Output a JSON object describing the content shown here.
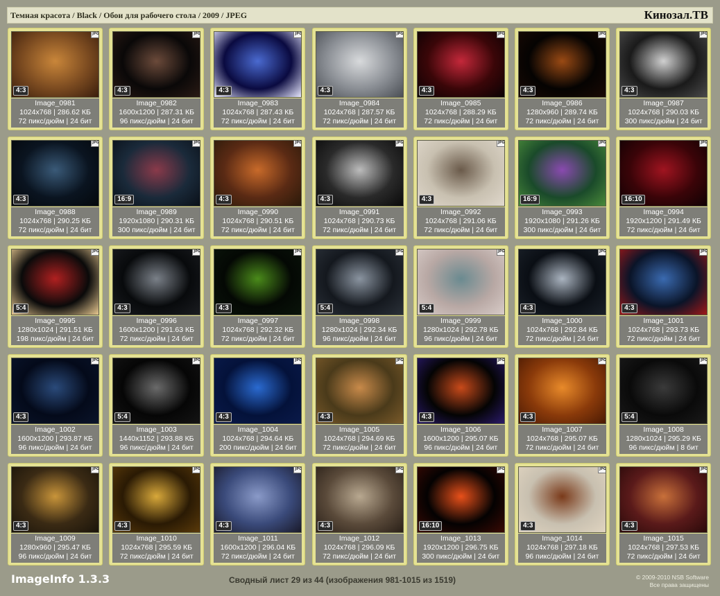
{
  "header": {
    "breadcrumb": "Темная красота / Black / Обои для рабочего стола / 2009 / JPEG",
    "brand": "Кинозал.ТВ"
  },
  "jpg_label": "JPG",
  "images": [
    {
      "name": "Image_0981",
      "dims": "1024x768",
      "size": "286.62 КБ",
      "dpi": "72 пикс/дюйм",
      "bits": "24 бит",
      "ratio": "4:3",
      "colors": [
        "#7a4a20",
        "#c9863a",
        "#3a1e0c"
      ]
    },
    {
      "name": "Image_0982",
      "dims": "1600x1200",
      "size": "287.31 КБ",
      "dpi": "96 пикс/дюйм",
      "bits": "24 бит",
      "ratio": "4:3",
      "colors": [
        "#0a0808",
        "#6b4a3a",
        "#2a1a14"
      ]
    },
    {
      "name": "Image_0983",
      "dims": "1024x768",
      "size": "287.43 КБ",
      "dpi": "72 пикс/дюйм",
      "bits": "24 бит",
      "ratio": "4:3",
      "colors": [
        "#0a0a40",
        "#4a6ad0",
        "#e8e8ff"
      ]
    },
    {
      "name": "Image_0984",
      "dims": "1024x768",
      "size": "287.57 КБ",
      "dpi": "72 пикс/дюйм",
      "bits": "24 бит",
      "ratio": "4:3",
      "colors": [
        "#8a8e94",
        "#d8dadc",
        "#4a4e54"
      ]
    },
    {
      "name": "Image_0985",
      "dims": "1024x768",
      "size": "288.29 КБ",
      "dpi": "72 пикс/дюйм",
      "bits": "24 бит",
      "ratio": "4:3",
      "colors": [
        "#3a0608",
        "#c4283a",
        "#0a0204"
      ]
    },
    {
      "name": "Image_0986",
      "dims": "1280x960",
      "size": "289.74 КБ",
      "dpi": "72 пикс/дюйм",
      "bits": "24 бит",
      "ratio": "4:3",
      "colors": [
        "#050302",
        "#9a4a14",
        "#1a0a04"
      ]
    },
    {
      "name": "Image_0987",
      "dims": "1024x768",
      "size": "290.03 КБ",
      "dpi": "300 пикс/дюйм",
      "bits": "24 бит",
      "ratio": "4:3",
      "colors": [
        "#1a1a1a",
        "#d0d0d0",
        "#4a4a4a"
      ]
    },
    {
      "name": "Image_0988",
      "dims": "1024x768",
      "size": "290.25 КБ",
      "dpi": "72 пикс/дюйм",
      "bits": "24 бит",
      "ratio": "4:3",
      "colors": [
        "#0a1420",
        "#3a5a78",
        "#04080c"
      ]
    },
    {
      "name": "Image_0989",
      "dims": "1920x1080",
      "size": "290.31 КБ",
      "dpi": "300 пикс/дюйм",
      "bits": "24 бит",
      "ratio": "16:9",
      "colors": [
        "#1a2a3a",
        "#8a3a4a",
        "#0a1018"
      ]
    },
    {
      "name": "Image_0990",
      "dims": "1024x768",
      "size": "290.51 КБ",
      "dpi": "72 пикс/дюйм",
      "bits": "24 бит",
      "ratio": "4:3",
      "colors": [
        "#5a2a14",
        "#c86a2a",
        "#2a1a0a"
      ]
    },
    {
      "name": "Image_0991",
      "dims": "1024x768",
      "size": "290.73 КБ",
      "dpi": "72 пикс/дюйм",
      "bits": "24 бит",
      "ratio": "4:3",
      "colors": [
        "#2a2a2a",
        "#bcbcbc",
        "#0a0a0a"
      ]
    },
    {
      "name": "Image_0992",
      "dims": "1024x768",
      "size": "291.06 КБ",
      "dpi": "72 пикс/дюйм",
      "bits": "24 бит",
      "ratio": "4:3",
      "colors": [
        "#c8c0b0",
        "#6a5a4a",
        "#e0d8cc"
      ]
    },
    {
      "name": "Image_0993",
      "dims": "1920x1080",
      "size": "291.26 КБ",
      "dpi": "300 пикс/дюйм",
      "bits": "24 бит",
      "ratio": "16:9",
      "colors": [
        "#1a4a2a",
        "#8a4ab0",
        "#4a8a3a"
      ]
    },
    {
      "name": "Image_0994",
      "dims": "1920x1200",
      "size": "291.49 КБ",
      "dpi": "72 пикс/дюйм",
      "bits": "24 бит",
      "ratio": "16:10",
      "colors": [
        "#3a0408",
        "#a01420",
        "#100204"
      ]
    },
    {
      "name": "Image_0995",
      "dims": "1280x1024",
      "size": "291.51 КБ",
      "dpi": "198 пикс/дюйм",
      "bits": "24 бит",
      "ratio": "5:4",
      "colors": [
        "#0a0a0a",
        "#b02020",
        "#e8c890"
      ]
    },
    {
      "name": "Image_0996",
      "dims": "1600x1200",
      "size": "291.63 КБ",
      "dpi": "72 пикс/дюйм",
      "bits": "24 бит",
      "ratio": "4:3",
      "colors": [
        "#080a0c",
        "#7a8088",
        "#1a1c20"
      ]
    },
    {
      "name": "Image_0997",
      "dims": "1024x768",
      "size": "292.32 КБ",
      "dpi": "72 пикс/дюйм",
      "bits": "24 бит",
      "ratio": "4:3",
      "colors": [
        "#040804",
        "#4a8a1a",
        "#0a140a"
      ]
    },
    {
      "name": "Image_0998",
      "dims": "1280x1024",
      "size": "292.34 КБ",
      "dpi": "96 пикс/дюйм",
      "bits": "24 бит",
      "ratio": "5:4",
      "colors": [
        "#14181e",
        "#8a94a0",
        "#2a3038"
      ]
    },
    {
      "name": "Image_0999",
      "dims": "1280x1024",
      "size": "292.78 КБ",
      "dpi": "96 пикс/дюйм",
      "bits": "24 бит",
      "ratio": "5:4",
      "colors": [
        "#b8a8a4",
        "#6a8a90",
        "#d8ccc8"
      ]
    },
    {
      "name": "Image_1000",
      "dims": "1024x768",
      "size": "292.84 КБ",
      "dpi": "72 пикс/дюйм",
      "bits": "24 бит",
      "ratio": "4:3",
      "colors": [
        "#0a0e14",
        "#aab4c0",
        "#1a2028"
      ]
    },
    {
      "name": "Image_1001",
      "dims": "1024x768",
      "size": "293.73 КБ",
      "dpi": "72 пикс/дюйм",
      "bits": "24 бит",
      "ratio": "4:3",
      "colors": [
        "#0a1428",
        "#3a6ab0",
        "#a01818"
      ]
    },
    {
      "name": "Image_1002",
      "dims": "1600x1200",
      "size": "293.87 КБ",
      "dpi": "96 пикс/дюйм",
      "bits": "24 бит",
      "ratio": "4:3",
      "colors": [
        "#040a1a",
        "#2a4a7a",
        "#0a142a"
      ]
    },
    {
      "name": "Image_1003",
      "dims": "1440x1152",
      "size": "293.88 КБ",
      "dpi": "96 пикс/дюйм",
      "bits": "24 бит",
      "ratio": "5:4",
      "colors": [
        "#060606",
        "#6a6a6a",
        "#141414"
      ]
    },
    {
      "name": "Image_1004",
      "dims": "1024x768",
      "size": "294.64 КБ",
      "dpi": "200 пикс/дюйм",
      "bits": "24 бит",
      "ratio": "4:3",
      "colors": [
        "#04123a",
        "#2a6ad0",
        "#0a1a4a"
      ]
    },
    {
      "name": "Image_1005",
      "dims": "1024x768",
      "size": "294.69 КБ",
      "dpi": "72 пикс/дюйм",
      "bits": "24 бит",
      "ratio": "4:3",
      "colors": [
        "#4a3a1a",
        "#c88a4a",
        "#7a5a2a"
      ]
    },
    {
      "name": "Image_1006",
      "dims": "1600x1200",
      "size": "295.07 КБ",
      "dpi": "96 пикс/дюйм",
      "bits": "24 бит",
      "ratio": "4:3",
      "colors": [
        "#040404",
        "#c84a1a",
        "#2a1a6a"
      ]
    },
    {
      "name": "Image_1007",
      "dims": "1024x768",
      "size": "295.07 КБ",
      "dpi": "72 пикс/дюйм",
      "bits": "24 бит",
      "ratio": "4:3",
      "colors": [
        "#8a3a0a",
        "#e88a2a",
        "#4a1a04"
      ]
    },
    {
      "name": "Image_1008",
      "dims": "1280x1024",
      "size": "295.29 КБ",
      "dpi": "96 пикс/дюйм",
      "bits": "8 бит",
      "ratio": "5:4",
      "colors": [
        "#0a0a0a",
        "#3a3a3a",
        "#1a1a1a"
      ]
    },
    {
      "name": "Image_1009",
      "dims": "1280x960",
      "size": "295.47 КБ",
      "dpi": "96 пикс/дюйм",
      "bits": "24 бит",
      "ratio": "4:3",
      "colors": [
        "#3a2a14",
        "#c8943a",
        "#1a140a"
      ]
    },
    {
      "name": "Image_1010",
      "dims": "1024x768",
      "size": "295.59 КБ",
      "dpi": "72 пикс/дюйм",
      "bits": "24 бит",
      "ratio": "4:3",
      "colors": [
        "#2a1a04",
        "#d8a83a",
        "#5a3a0a"
      ]
    },
    {
      "name": "Image_1011",
      "dims": "1600x1200",
      "size": "296.04 КБ",
      "dpi": "72 пикс/дюйм",
      "bits": "24 бит",
      "ratio": "4:3",
      "colors": [
        "#3a4a7a",
        "#8a9ac8",
        "#1a1a2a"
      ]
    },
    {
      "name": "Image_1012",
      "dims": "1024x768",
      "size": "296.09 КБ",
      "dpi": "72 пикс/дюйм",
      "bits": "24 бит",
      "ratio": "4:3",
      "colors": [
        "#5a4a3a",
        "#b8a890",
        "#2a2018"
      ]
    },
    {
      "name": "Image_1013",
      "dims": "1920x1200",
      "size": "296.75 КБ",
      "dpi": "300 пикс/дюйм",
      "bits": "24 бит",
      "ratio": "16:10",
      "colors": [
        "#040202",
        "#e8501a",
        "#3a0a04"
      ]
    },
    {
      "name": "Image_1014",
      "dims": "1024x768",
      "size": "297.18 КБ",
      "dpi": "96 пикс/дюйм",
      "bits": "24 бит",
      "ratio": "4:3",
      "colors": [
        "#c8c0b0",
        "#7a3a1a",
        "#e0d4c0"
      ]
    },
    {
      "name": "Image_1015",
      "dims": "1024x768",
      "size": "297.53 КБ",
      "dpi": "72 пикс/дюйм",
      "bits": "24 бит",
      "ratio": "4:3",
      "colors": [
        "#5a1a1a",
        "#c8703a",
        "#2a0a0a"
      ]
    }
  ],
  "footer": {
    "app": "ImageInfo 1.3.3",
    "sheet": "Сводный лист 29 из 44 (изображения 981-1015 из 1519)",
    "copyright": "© 2009-2010 NSB Software",
    "rights": "Все права защищены"
  }
}
